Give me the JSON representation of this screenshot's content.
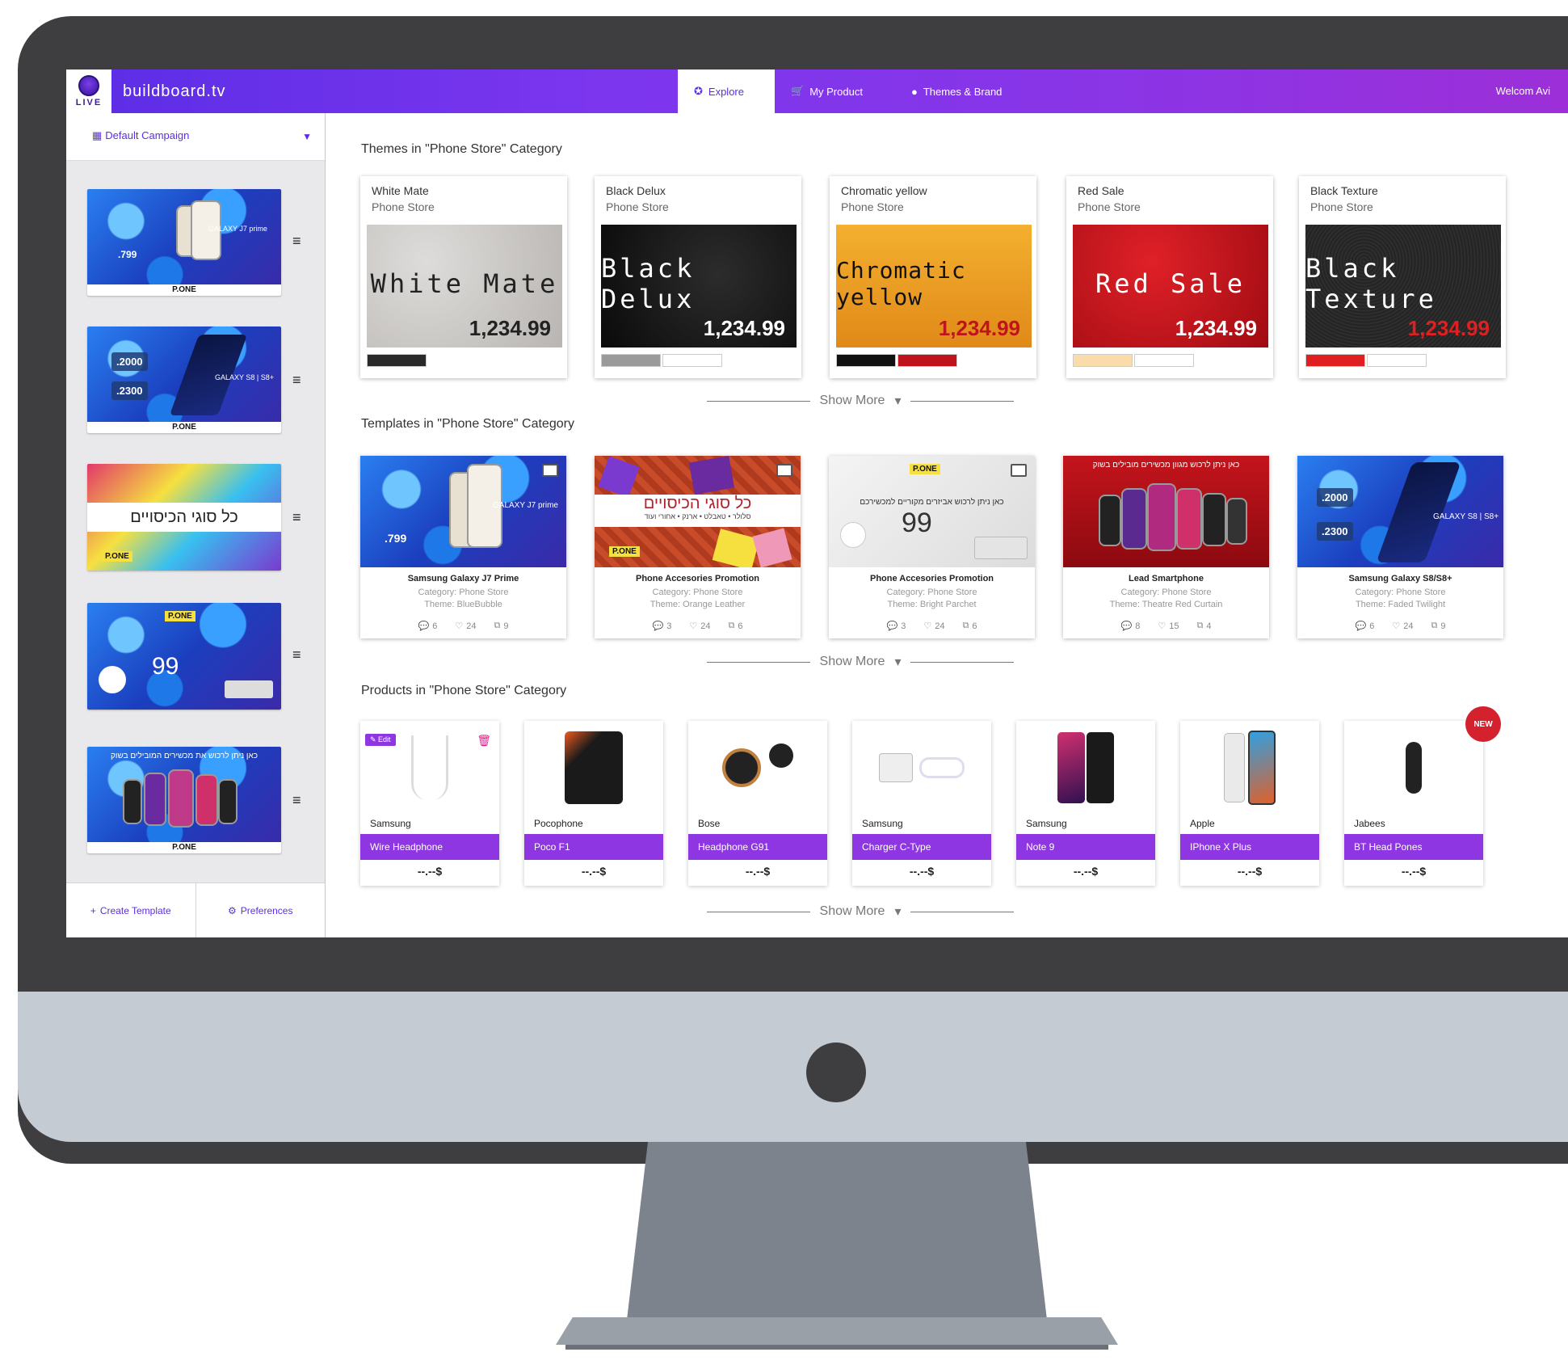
{
  "app": {
    "brand": "buildboard.tv",
    "logo_text": "LIVE",
    "welcome": "Welcom Avi"
  },
  "nav": {
    "explore": "Explore",
    "my_product": "My Product",
    "themes_brand": "Themes & Brand"
  },
  "sidebar": {
    "campaign": "Default Campaign",
    "create_template": "Create Template",
    "preferences": "Preferences"
  },
  "sections": {
    "themes_title": "Themes in \"Phone Store\" Category",
    "templates_title": "Templates in \"Phone Store\" Category",
    "products_title": "Products in \"Phone Store\" Category",
    "show_more": "Show More"
  },
  "themes": [
    {
      "name": "White Mate",
      "category": "Phone Store",
      "display": "White Mate",
      "price": "1,234.99",
      "bg": "#c9c7c4",
      "text_color": "#222222",
      "price_color": "#222222",
      "swatches": [
        "#2a2a2a"
      ]
    },
    {
      "name": "Black Delux",
      "category": "Phone Store",
      "display": "Black Delux",
      "price": "1,234.99",
      "bg": "#141414",
      "text_color": "#ffffff",
      "price_color": "#ffffff",
      "swatches": [
        "#9a9a9a",
        "#ffffff"
      ]
    },
    {
      "name": "Chromatic yellow",
      "category": "Phone Store",
      "display": "Chromatic yellow",
      "price": "1,234.99",
      "bg": "#f0a020",
      "text_color": "#111111",
      "price_color": "#c0141c",
      "swatches": [
        "#111111",
        "#c0141c"
      ]
    },
    {
      "name": "Red Sale",
      "category": "Phone Store",
      "display": "Red Sale",
      "price": "1,234.99",
      "bg": "#c4141c",
      "text_color": "#ffffff",
      "price_color": "#ffffff",
      "swatches": [
        "#f9dcaa",
        "#ffffff"
      ]
    },
    {
      "name": "Black Texture",
      "category": "Phone Store",
      "display": "Black Texture",
      "price": "1,234.99",
      "bg": "#2a2a2a",
      "text_color": "#ffffff",
      "price_color": "#e02020",
      "swatches": [
        "#e02020",
        "#ffffff"
      ]
    }
  ],
  "templates": [
    {
      "name": "Samsung Galaxy J7 Prime",
      "category": "Category: Phone Store",
      "theme": "Theme: BlueBubble",
      "comments": "6",
      "likes": "24",
      "copies": "9"
    },
    {
      "name": "Phone Accesories Promotion",
      "category": "Category: Phone Store",
      "theme": "Theme: Orange Leather",
      "comments": "3",
      "likes": "24",
      "copies": "6"
    },
    {
      "name": "Phone Accesories Promotion",
      "category": "Category: Phone Store",
      "theme": "Theme: Bright Parchet",
      "comments": "3",
      "likes": "24",
      "copies": "6"
    },
    {
      "name": "Lead Smartphone",
      "category": "Category: Phone Store",
      "theme": "Theme: Theatre Red Curtain",
      "comments": "8",
      "likes": "15",
      "copies": "4"
    },
    {
      "name": "Samsung Galaxy S8/S8+",
      "category": "Category: Phone Store",
      "theme": "Theme: Faded Twilight",
      "comments": "6",
      "likes": "24",
      "copies": "9"
    }
  ],
  "template_art": {
    "t1_model": "GALAXY J7 prime",
    "t1_price": ".799",
    "t2_headline": "כל סוגי הכיסויים",
    "t2_sub": "סלולר • טאבלט • ארנק • אחורי ועוד",
    "t2_logo": "P.ONE",
    "t3_headline": "כאן ניתן לרכוש אביזרים מקוריים למכשירכם",
    "t3_price": "99",
    "t3_logo": "P.ONE",
    "t4_headline": "כאן ניתן לרכוש מגוון מכשירים מובילים בשוק",
    "t5_price1": ".2000",
    "t5_price2": ".2300",
    "t5_model": "GALAXY S8 | S8+"
  },
  "sidebar_art": {
    "s1_model": "GALAXY J7 prime",
    "s1_price": ".799",
    "s1_logo": "P.ONE",
    "s2_price1": ".2000",
    "s2_price2": ".2300",
    "s2_model": "GALAXY S8 | S8+",
    "s2_logo": "P.ONE",
    "s3_headline": "כל סוגי הכיסויים",
    "s3_logo": "P.ONE",
    "s4_logo": "P.ONE",
    "s4_price": "99",
    "s5_headline": "כאן ניתן לרכוש את מכשירים המובילים בשוק",
    "s5_logo": "P.ONE"
  },
  "products": [
    {
      "brand": "Samsung",
      "name": "Wire Headphone",
      "price": "--.--$"
    },
    {
      "brand": "Pocophone",
      "name": "Poco F1",
      "price": "--.--$"
    },
    {
      "brand": "Bose",
      "name": "Headphone G91",
      "price": "--.--$"
    },
    {
      "brand": "Samsung",
      "name": "Charger C-Type",
      "price": "--.--$"
    },
    {
      "brand": "Samsung",
      "name": "Note 9",
      "price": "--.--$"
    },
    {
      "brand": "Apple",
      "name": "IPhone X Plus",
      "price": "--.--$"
    },
    {
      "brand": "Jabees",
      "name": "BT Head Pones",
      "price": "--.--$"
    }
  ],
  "product_badges": {
    "edit": "Edit",
    "new": "NEW"
  },
  "colors": {
    "accent": "#5b2de6",
    "product_bar": "#8f36e3",
    "new_badge": "#d4212e"
  }
}
